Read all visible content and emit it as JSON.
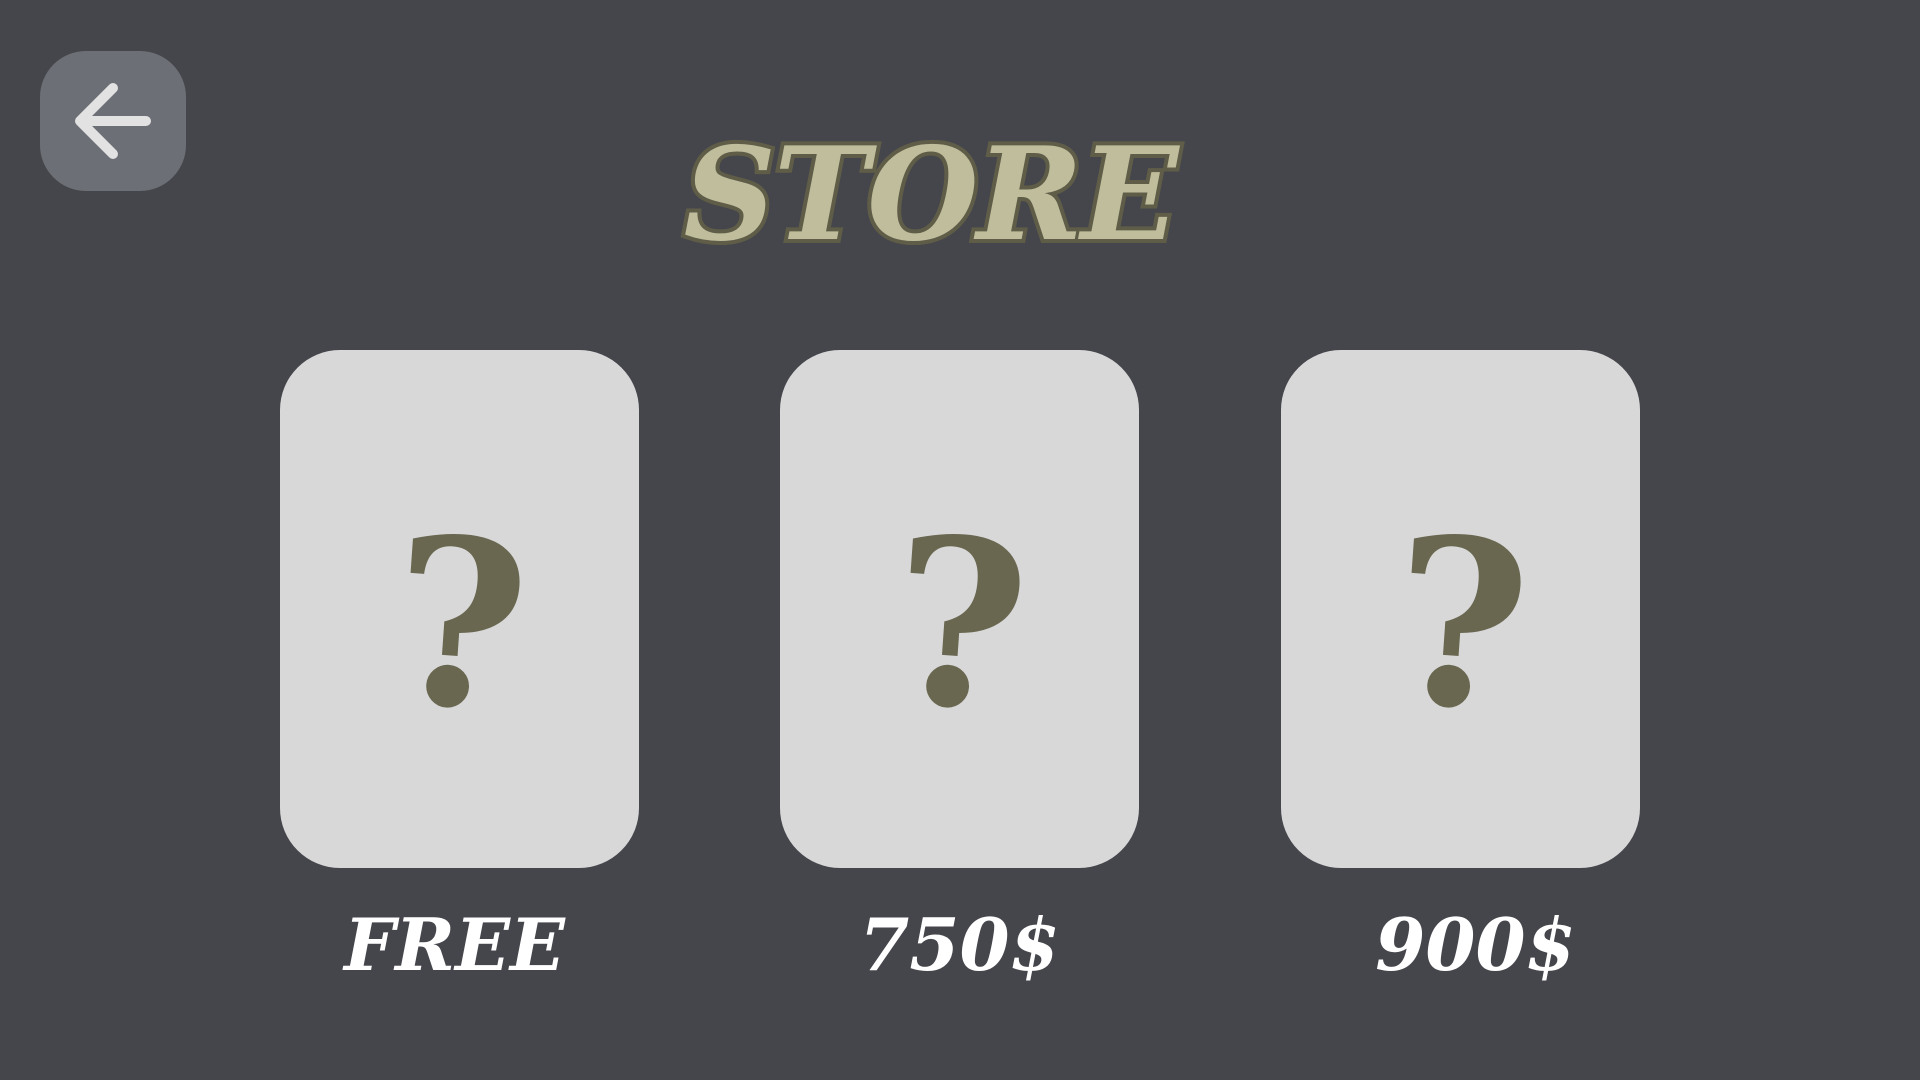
{
  "screen": {
    "title": "STORE",
    "back_icon": "arrow-left-icon"
  },
  "store": {
    "items": [
      {
        "symbol": "?",
        "price": "FREE"
      },
      {
        "symbol": "?",
        "price": "750$"
      },
      {
        "symbol": "?",
        "price": "900$"
      }
    ]
  },
  "colors": {
    "background": "#45464c",
    "card": "#d8d8d8",
    "question_mark": "#696750",
    "title_fill": "#bfbd9c",
    "title_outline": "#5f5d47",
    "back_button": "#6c6f75",
    "price_text": "#ffffff"
  }
}
